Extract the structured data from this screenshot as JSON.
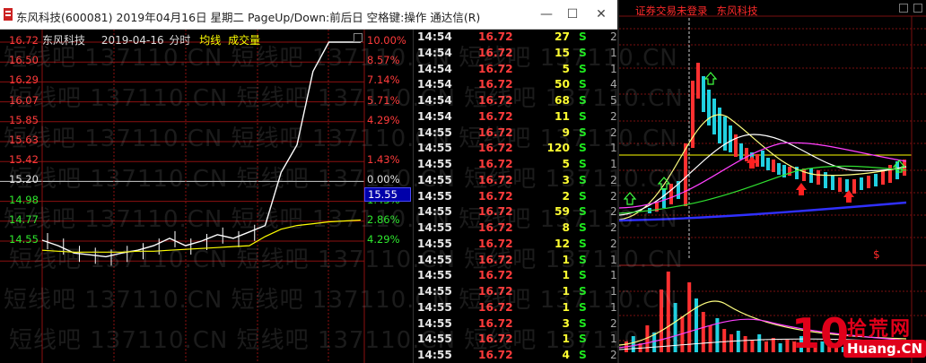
{
  "window": {
    "title": "东风科技(600081) 2019年04月16日 星期二 PageUp/Down:前后日 空格键:操作 通达信(R)",
    "min_glyph": "—",
    "max_glyph": "☐",
    "close_glyph": "✕"
  },
  "chart_header": {
    "stock": "东风科技",
    "date": "2019-04-16",
    "mode": "分时",
    "avg_label": "均线",
    "vol_label": "成交量"
  },
  "price_axis": [
    {
      "text": "16.72",
      "color": "#ff3b3b"
    },
    {
      "text": "16.50",
      "color": "#ff3b3b"
    },
    {
      "text": "16.29",
      "color": "#ff3b3b"
    },
    {
      "text": "16.07",
      "color": "#ff3b3b"
    },
    {
      "text": "15.85",
      "color": "#ff3b3b"
    },
    {
      "text": "15.63",
      "color": "#ff3b3b"
    },
    {
      "text": "15.42",
      "color": "#ff3b3b"
    },
    {
      "text": "15.20",
      "color": "#e8e8e8"
    },
    {
      "text": "14.98",
      "color": "#2ee82e"
    },
    {
      "text": "14.77",
      "color": "#2ee82e"
    },
    {
      "text": "14.55",
      "color": "#2ee82e"
    }
  ],
  "pct_axis": [
    {
      "text": "10.00%",
      "color": "#ff3b3b"
    },
    {
      "text": "8.57%",
      "color": "#ff3b3b"
    },
    {
      "text": "7.14%",
      "color": "#ff3b3b"
    },
    {
      "text": "5.71%",
      "color": "#ff3b3b"
    },
    {
      "text": "4.29%",
      "color": "#ff3b3b"
    },
    {
      "text": "",
      "color": "#ff3b3b"
    },
    {
      "text": "1.43%",
      "color": "#ff3b3b"
    },
    {
      "text": "0.00%",
      "color": "#e8e8e8"
    },
    {
      "text": "1.43%",
      "color": "#2ee82e"
    },
    {
      "text": "2.86%",
      "color": "#2ee82e"
    },
    {
      "text": "4.29%",
      "color": "#2ee82e"
    }
  ],
  "cursor_value": "15.55",
  "ticks": [
    {
      "time": "14:54",
      "price": "16.72",
      "vol": "27",
      "flag": "S",
      "n": "2"
    },
    {
      "time": "14:54",
      "price": "16.72",
      "vol": "15",
      "flag": "S",
      "n": "1"
    },
    {
      "time": "14:54",
      "price": "16.72",
      "vol": "5",
      "flag": "S",
      "n": "1"
    },
    {
      "time": "14:54",
      "price": "16.72",
      "vol": "50",
      "flag": "S",
      "n": "4"
    },
    {
      "time": "14:54",
      "price": "16.72",
      "vol": "68",
      "flag": "S",
      "n": "5"
    },
    {
      "time": "14:54",
      "price": "16.72",
      "vol": "11",
      "flag": "S",
      "n": "2"
    },
    {
      "time": "14:55",
      "price": "16.72",
      "vol": "9",
      "flag": "S",
      "n": "2"
    },
    {
      "time": "14:55",
      "price": "16.72",
      "vol": "120",
      "flag": "S",
      "n": "1"
    },
    {
      "time": "14:55",
      "price": "16.72",
      "vol": "5",
      "flag": "S",
      "n": "1"
    },
    {
      "time": "14:55",
      "price": "16.72",
      "vol": "3",
      "flag": "S",
      "n": "2"
    },
    {
      "time": "14:55",
      "price": "16.72",
      "vol": "2",
      "flag": "S",
      "n": "2"
    },
    {
      "time": "14:55",
      "price": "16.72",
      "vol": "59",
      "flag": "S",
      "n": "2"
    },
    {
      "time": "14:55",
      "price": "16.72",
      "vol": "8",
      "flag": "S",
      "n": "2"
    },
    {
      "time": "14:55",
      "price": "16.72",
      "vol": "12",
      "flag": "S",
      "n": "2"
    },
    {
      "time": "14:55",
      "price": "16.72",
      "vol": "1",
      "flag": "S",
      "n": "1"
    },
    {
      "time": "14:55",
      "price": "16.72",
      "vol": "1",
      "flag": "S",
      "n": "1"
    },
    {
      "time": "14:55",
      "price": "16.72",
      "vol": "1",
      "flag": "S",
      "n": "1"
    },
    {
      "time": "14:55",
      "price": "16.72",
      "vol": "1",
      "flag": "S",
      "n": "1"
    },
    {
      "time": "14:55",
      "price": "16.72",
      "vol": "3",
      "flag": "S",
      "n": "2"
    },
    {
      "time": "14:55",
      "price": "16.72",
      "vol": "1",
      "flag": "S",
      "n": "1"
    },
    {
      "time": "14:55",
      "price": "16.72",
      "vol": "4",
      "flag": "S",
      "n": "2"
    }
  ],
  "right_window": {
    "status": "证券交易未登录",
    "stock": "东风科技",
    "marker": "$"
  },
  "watermark": {
    "text": "短线吧 137110.CN 短线吧 137110.CN 短线吧 137110.CN"
  },
  "logo": {
    "number": "10",
    "cn": "拾荒网",
    "domain": "Huang.CN"
  },
  "colors": {
    "grid_red": "#8b1111",
    "price_line": "#ffffff",
    "avg_line": "#ffff00",
    "up": "#ff3b3b",
    "down": "#2ee82e"
  },
  "chart_data": {
    "type": "line",
    "title": "",
    "xlabel": "",
    "ylabel": "",
    "ylim": [
      14.55,
      16.72
    ],
    "series": [
      {
        "name": "",
        "x": [
          0,
          1,
          2,
          3,
          4,
          5,
          6,
          7,
          8,
          9,
          10,
          11,
          12,
          13,
          14,
          15,
          16,
          17,
          18,
          19,
          20
        ],
        "values": [
          14.56,
          14.5,
          14.42,
          14.4,
          14.38,
          14.42,
          14.45,
          14.5,
          14.58,
          14.5,
          14.55,
          14.62,
          14.58,
          14.65,
          14.72,
          15.3,
          15.6,
          16.4,
          16.72,
          16.72,
          16.72
        ]
      },
      {
        "name": "",
        "x": [
          0,
          1,
          2,
          3,
          4,
          5,
          6,
          7,
          8,
          9,
          10,
          11,
          12,
          13,
          14,
          15,
          16,
          17,
          18,
          19,
          20
        ],
        "values": [
          14.45,
          14.44,
          14.43,
          14.43,
          14.43,
          14.43,
          14.44,
          14.44,
          14.45,
          14.46,
          14.47,
          14.48,
          14.49,
          14.5,
          14.6,
          14.68,
          14.72,
          14.74,
          14.76,
          14.77,
          14.78
        ]
      }
    ]
  }
}
